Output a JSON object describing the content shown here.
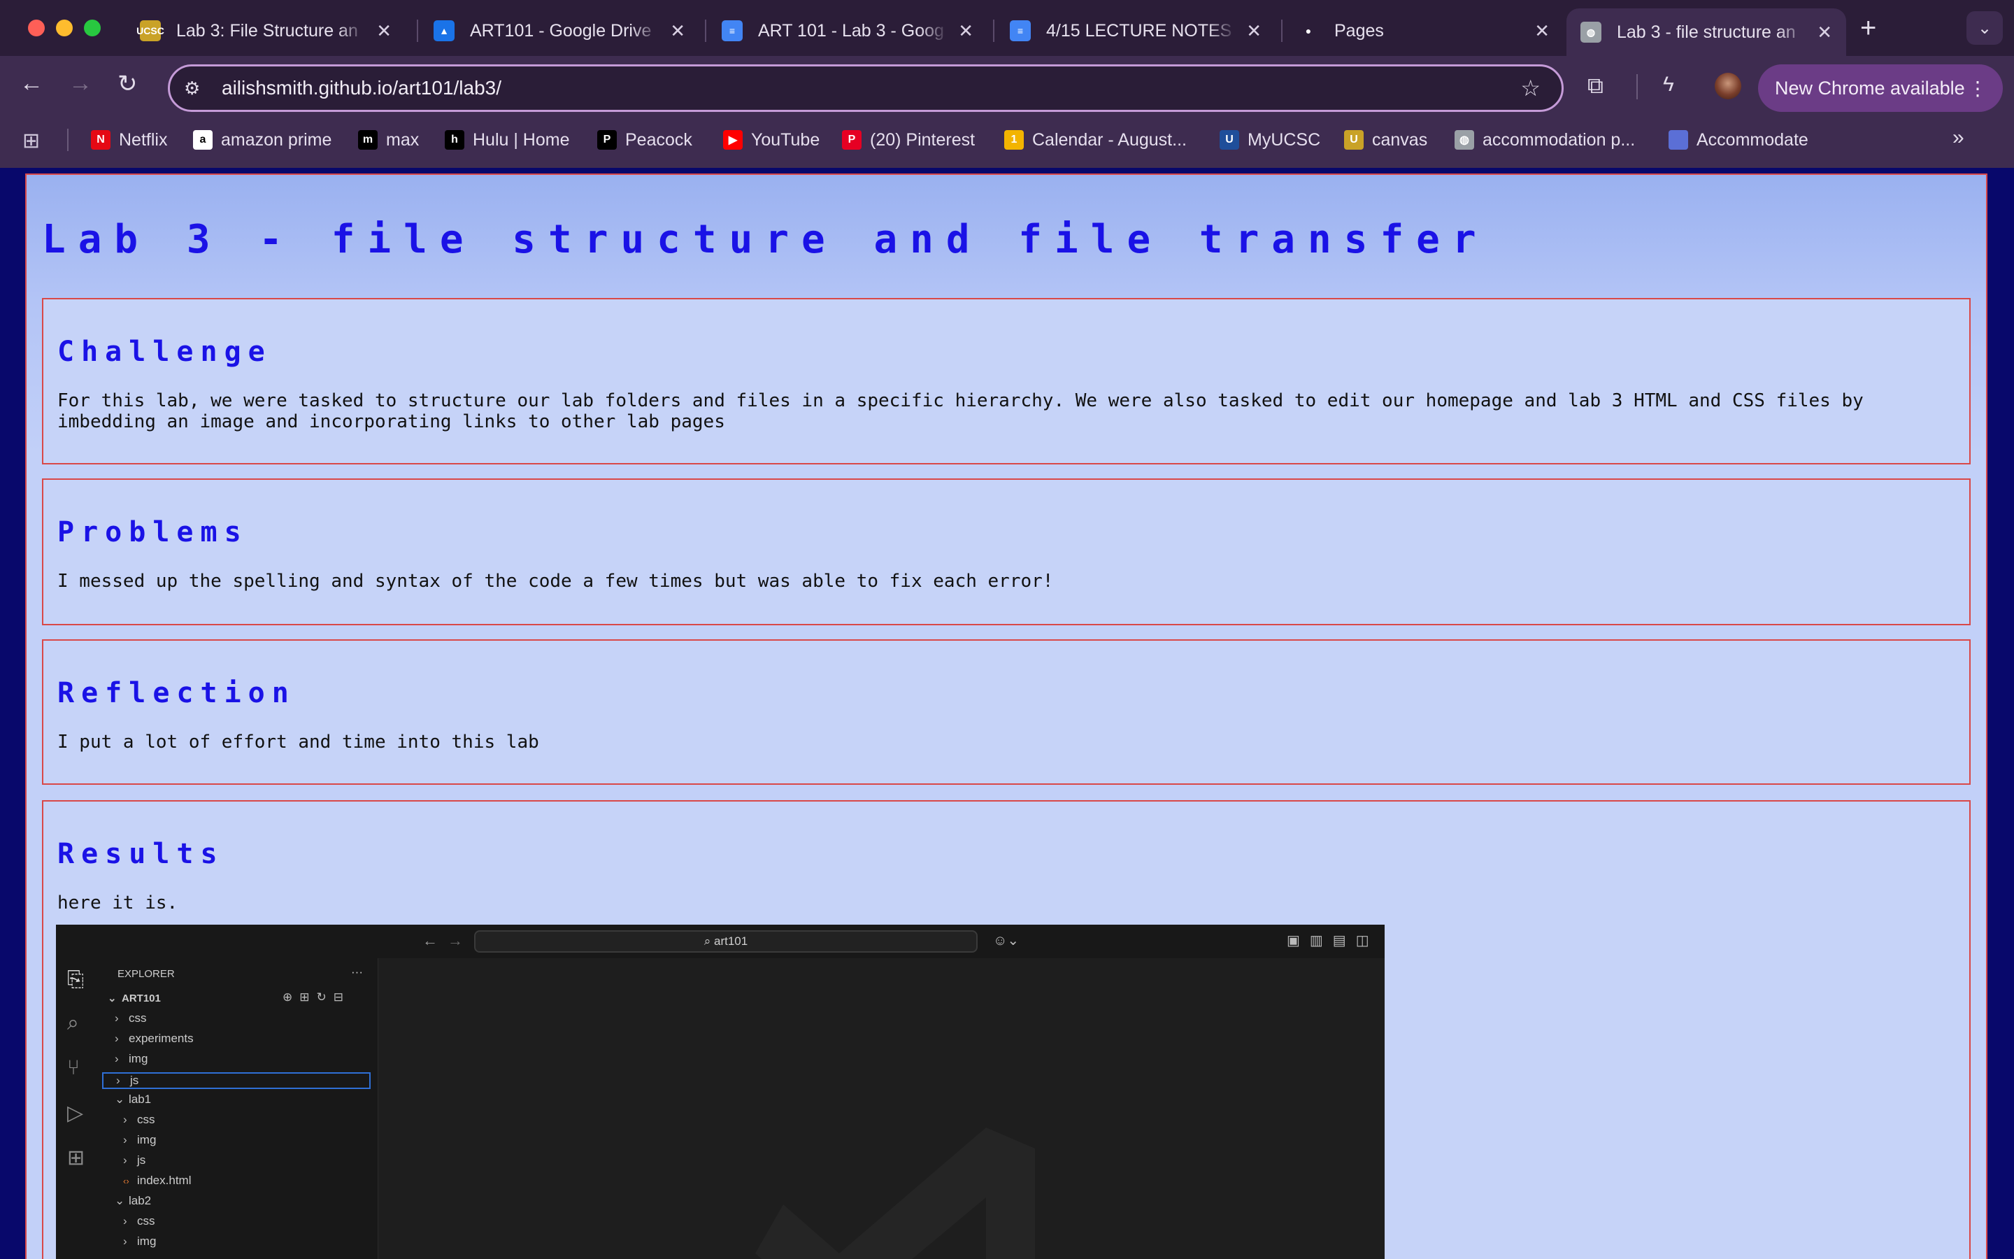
{
  "browser": {
    "tabs": [
      {
        "title": "Lab 3: File Structure an",
        "icon": "ucsc-favicon",
        "color": "#c9a227",
        "glyph": "UCSC"
      },
      {
        "title": "ART101 - Google Drive",
        "icon": "google-drive-icon",
        "color": "#1a73e8",
        "glyph": "▲"
      },
      {
        "title": "ART 101 - Lab 3 - Goog",
        "icon": "google-docs-icon",
        "color": "#4285f4",
        "glyph": "≡"
      },
      {
        "title": "4/15 LECTURE NOTES -",
        "icon": "google-docs-icon",
        "color": "#4285f4",
        "glyph": "≡"
      },
      {
        "title": "Pages",
        "icon": "github-icon",
        "color": "#ffffff",
        "glyph": "●"
      },
      {
        "title": "Lab 3 - file structure an",
        "icon": "globe-icon",
        "color": "#9aa0a6",
        "glyph": "◍"
      }
    ],
    "url": "ailishsmith.github.io/art101/lab3/",
    "new_chrome_label": "New Chrome available",
    "bookmarks": [
      {
        "label": "Netflix",
        "icon": "netflix-icon",
        "color": "#e50914",
        "glyph": "N"
      },
      {
        "label": "amazon prime",
        "icon": "amazon-icon",
        "color": "#ffffff",
        "glyph": "a"
      },
      {
        "label": "max",
        "icon": "max-icon",
        "color": "#000000",
        "glyph": "m"
      },
      {
        "label": "Hulu | Home",
        "icon": "hulu-icon",
        "color": "#000000",
        "glyph": "h"
      },
      {
        "label": "Peacock",
        "icon": "peacock-icon",
        "color": "#000000",
        "glyph": "P"
      },
      {
        "label": "YouTube",
        "icon": "youtube-icon",
        "color": "#ff0000",
        "glyph": "▶"
      },
      {
        "label": "(20) Pinterest",
        "icon": "pinterest-icon",
        "color": "#e60023",
        "glyph": "P"
      },
      {
        "label": "Calendar - August...",
        "icon": "calendar-icon",
        "color": "#f3b400",
        "glyph": "1"
      },
      {
        "label": "MyUCSC",
        "icon": "ucsc-icon",
        "color": "#1f4e9a",
        "glyph": "U"
      },
      {
        "label": "canvas",
        "icon": "ucsc-icon",
        "color": "#c9a227",
        "glyph": "U"
      },
      {
        "label": "accommodation p...",
        "icon": "globe-icon",
        "color": "#9aa0a6",
        "glyph": "◍"
      },
      {
        "label": "Accommodate",
        "icon": "accommodate-icon",
        "color": "#5b6fd6",
        "glyph": ""
      }
    ]
  },
  "page": {
    "title": "Lab 3 - file structure and file transfer",
    "sections": [
      {
        "heading": "Challenge",
        "body": "For this lab, we were tasked to structure our lab folders and files in a specific hierarchy. We were also tasked to edit our homepage and lab 3 HTML and CSS files by imbedding an image and incorporating links to other lab pages"
      },
      {
        "heading": "Problems",
        "body": "I messed up the spelling and syntax of the code a few times but was able to fix each error!"
      },
      {
        "heading": "Reflection",
        "body": "I put a lot of effort and time into this lab"
      },
      {
        "heading": "Results",
        "body": "here it is."
      }
    ]
  },
  "vscode": {
    "search": "art101",
    "explorer_title": "EXPLORER",
    "root": "ART101",
    "tree": [
      {
        "label": "css",
        "depth": 0,
        "open": false
      },
      {
        "label": "experiments",
        "depth": 0,
        "open": false
      },
      {
        "label": "img",
        "depth": 0,
        "open": false
      },
      {
        "label": "js",
        "depth": 0,
        "open": false,
        "selected": true
      },
      {
        "label": "lab1",
        "depth": 0,
        "open": true
      },
      {
        "label": "css",
        "depth": 1,
        "open": false
      },
      {
        "label": "img",
        "depth": 1,
        "open": false
      },
      {
        "label": "js",
        "depth": 1,
        "open": false
      },
      {
        "label": "index.html",
        "depth": 1,
        "file": true
      },
      {
        "label": "lab2",
        "depth": 0,
        "open": true
      },
      {
        "label": "css",
        "depth": 1,
        "open": false
      },
      {
        "label": "img",
        "depth": 1,
        "open": false
      }
    ]
  }
}
